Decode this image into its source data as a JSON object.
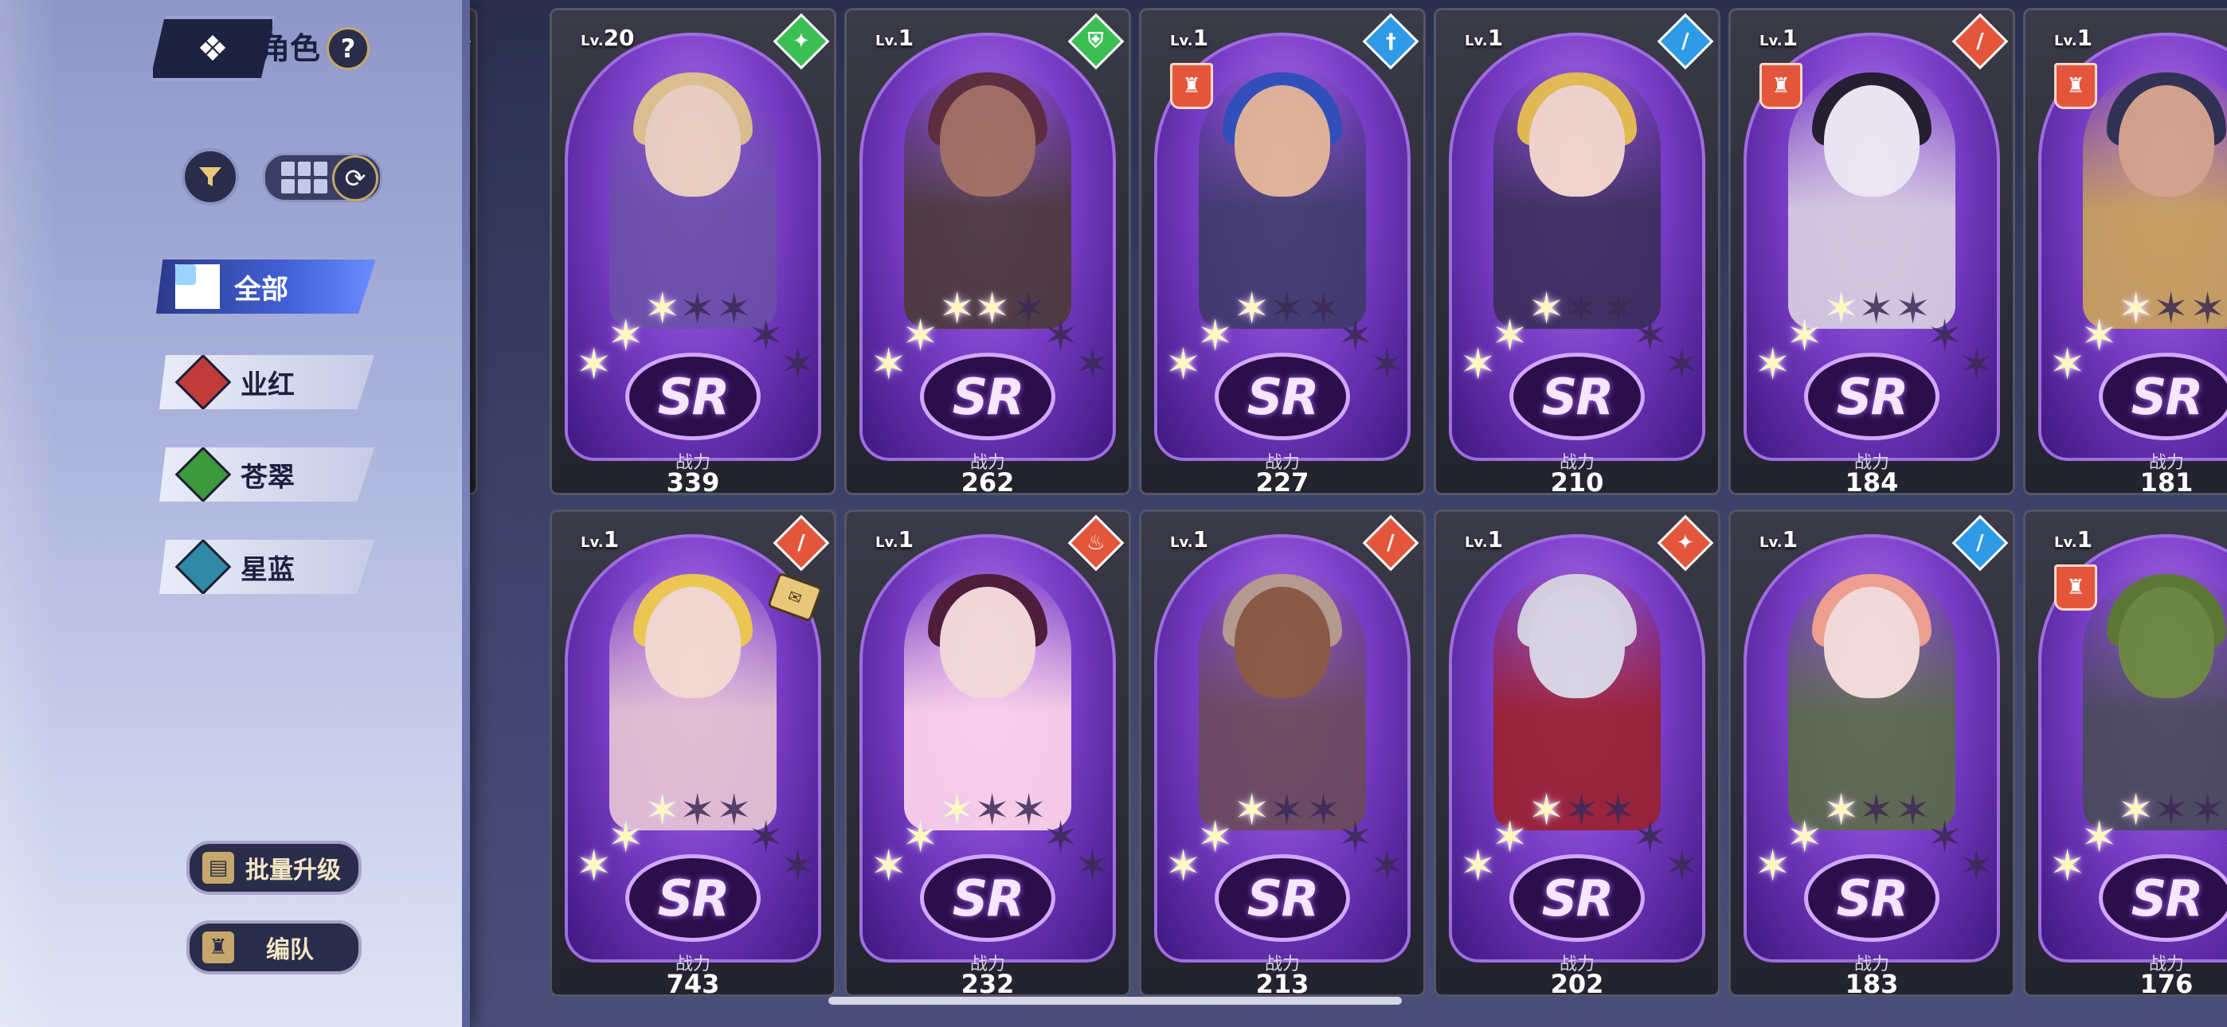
{
  "header": {
    "title": "角色",
    "help_glyph": "?",
    "back_glyph": "❖"
  },
  "filters": [
    {
      "label": "全部",
      "element": "all",
      "color": "#4361d6",
      "active": true
    },
    {
      "label": "业红",
      "element": "red",
      "color": "#c23b3b",
      "active": false
    },
    {
      "label": "苍翠",
      "element": "green",
      "color": "#3c9a3c",
      "active": false
    },
    {
      "label": "星蓝",
      "element": "blue",
      "color": "#2f8aa6",
      "active": false
    }
  ],
  "actions": {
    "batch_upgrade": "批量升级",
    "formation": "编队"
  },
  "power_label": "战力",
  "rarity_label": "SR",
  "colors": {
    "red": "#e4563c",
    "green": "#3bbf54",
    "blue": "#2f9ae6"
  },
  "row1": [
    {
      "level": "20",
      "power": "339",
      "class_color": "green",
      "class_glyph": "✦",
      "stars": 3,
      "tower": false,
      "hair": "#e1c88a",
      "skin": "#efd6bf",
      "cloth": "#6b4fa8"
    },
    {
      "level": "1",
      "power": "262",
      "class_color": "green",
      "class_glyph": "⛨",
      "stars": 4,
      "tower": false,
      "hair": "#5a2a34",
      "skin": "#a0705c",
      "cloth": "#4a3a3a"
    },
    {
      "level": "1",
      "power": "227",
      "class_color": "blue",
      "class_glyph": "†",
      "stars": 3,
      "tower": true,
      "hair": "#2a4fb8",
      "skin": "#e4b895",
      "cloth": "#3e3a6a"
    },
    {
      "level": "1",
      "power": "210",
      "class_color": "blue",
      "class_glyph": "∕",
      "stars": 3,
      "tower": false,
      "hair": "#e9c24a",
      "skin": "#f6dccb",
      "cloth": "#3a2d5a"
    },
    {
      "level": "1",
      "power": "184",
      "class_color": "red",
      "class_glyph": "∕",
      "stars": 3,
      "tower": true,
      "hair": "#1c1c24",
      "skin": "#f2f0f3",
      "cloth": "#d7cfe0"
    },
    {
      "level": "1",
      "power": "181",
      "class_color": "red",
      "class_glyph": "✚",
      "stars": 3,
      "tower": true,
      "hair": "#2a2f4a",
      "skin": "#d7a787",
      "cloth": "#c9a25a"
    }
  ],
  "row2": [
    {
      "level": "1",
      "power": "743",
      "class_color": "red",
      "class_glyph": "∕",
      "stars": 3,
      "tower": false,
      "ticket": true,
      "hair": "#f5d04a",
      "skin": "#f8e1d0",
      "cloth": "#e6c4d4"
    },
    {
      "level": "1",
      "power": "232",
      "class_color": "red",
      "class_glyph": "♨",
      "stars": 3,
      "tower": false,
      "hair": "#4a1a2e",
      "skin": "#f8e1d8",
      "cloth": "#ffd6ea"
    },
    {
      "level": "1",
      "power": "213",
      "class_color": "red",
      "class_glyph": "∕",
      "stars": 3,
      "tower": false,
      "hair": "#b8a08a",
      "skin": "#8a5a3a",
      "cloth": "#6a4a5a"
    },
    {
      "level": "1",
      "power": "202",
      "class_color": "red",
      "class_glyph": "✦",
      "stars": 3,
      "tower": false,
      "hair": "#d8d8e0",
      "skin": "#dcdde4",
      "cloth": "#9a2030"
    },
    {
      "level": "1",
      "power": "183",
      "class_color": "blue",
      "class_glyph": "∕",
      "stars": 3,
      "tower": false,
      "hair": "#f5a58a",
      "skin": "#f9e4da",
      "cloth": "#5a6a4a"
    },
    {
      "level": "1",
      "power": "176",
      "class_color": "red",
      "class_glyph": "✚",
      "stars": 3,
      "tower": true,
      "hair": "#5a7a2a",
      "skin": "#6a8a3a",
      "cloth": "#4a4a5a"
    }
  ]
}
